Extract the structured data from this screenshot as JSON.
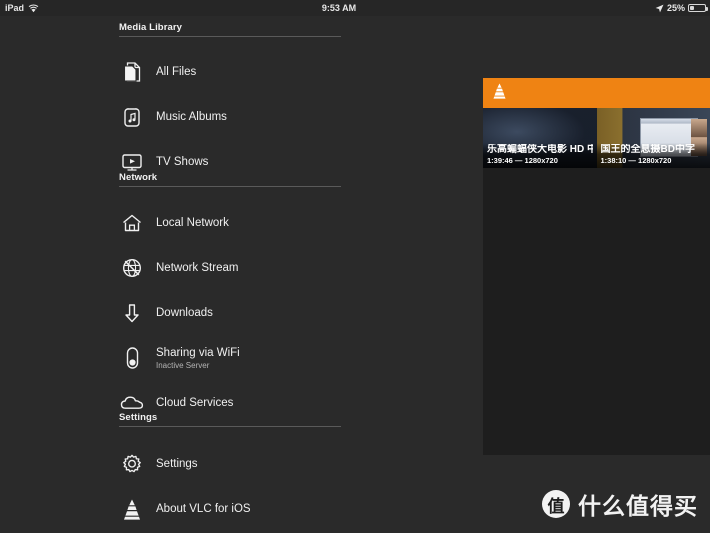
{
  "status_bar": {
    "device": "iPad",
    "wifi_icon": "wifi-icon",
    "time": "9:53 AM",
    "location_icon": "location-arrow-icon",
    "battery_percent": "25%",
    "battery_level": 25
  },
  "sidebar": {
    "sections": [
      {
        "title": "Media Library",
        "items": [
          {
            "label": "All Files",
            "icon": "files-icon"
          },
          {
            "label": "Music Albums",
            "icon": "music-album-icon"
          },
          {
            "label": "TV Shows",
            "icon": "tv-icon"
          }
        ]
      },
      {
        "title": "Network",
        "items": [
          {
            "label": "Local Network",
            "icon": "home-icon"
          },
          {
            "label": "Network Stream",
            "icon": "globe-icon"
          },
          {
            "label": "Downloads",
            "icon": "download-arrow-icon"
          },
          {
            "label": "Sharing via WiFi",
            "subtitle": "Inactive Server",
            "icon": "toggle-switch-icon"
          },
          {
            "label": "Cloud Services",
            "icon": "cloud-icon"
          }
        ]
      },
      {
        "title": "Settings",
        "items": [
          {
            "label": "Settings",
            "icon": "gear-icon"
          },
          {
            "label": "About VLC for iOS",
            "icon": "vlc-cone-icon"
          }
        ]
      }
    ]
  },
  "content": {
    "navbar": {
      "icon": "vlc-cone-icon",
      "accent_color": "#ef8313"
    },
    "videos": [
      {
        "title": "乐高蝙蝠侠大电影 HD 中英双字",
        "meta": "1:39:46 — 1280x720"
      },
      {
        "title": "国王的全息摄BD中字",
        "meta": "1:38:10 — 1280x720"
      }
    ]
  },
  "watermark": {
    "badge": "值",
    "text": "什么值得买"
  },
  "colors": {
    "background": "#2a2a2a",
    "panel": "#1e1e1e",
    "accent": "#ef8313",
    "text": "#f0f0f0",
    "subtext": "#b4b4b4",
    "divider": "#5a5a5a"
  }
}
